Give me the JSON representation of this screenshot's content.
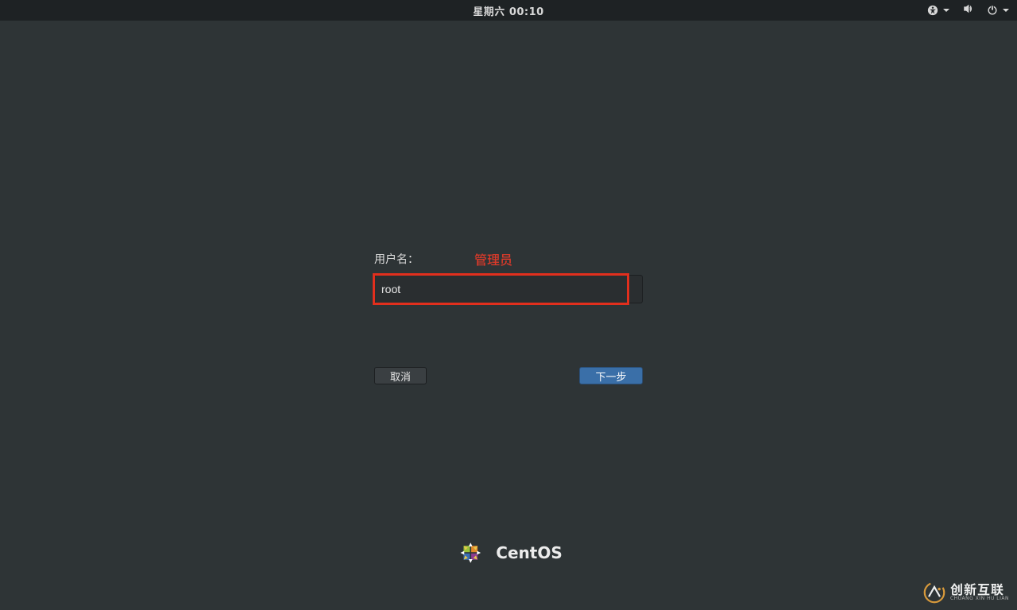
{
  "topbar": {
    "datetime": "星期六 00:10"
  },
  "login": {
    "username_label": "用户名：",
    "annotation": "管理员",
    "username_value": "root",
    "cancel_label": "取消",
    "next_label": "下一步"
  },
  "branding": {
    "os_name": "CentOS"
  },
  "watermark": {
    "cn": "创新互联",
    "en": "CHUANG XIN HU LIAN"
  }
}
